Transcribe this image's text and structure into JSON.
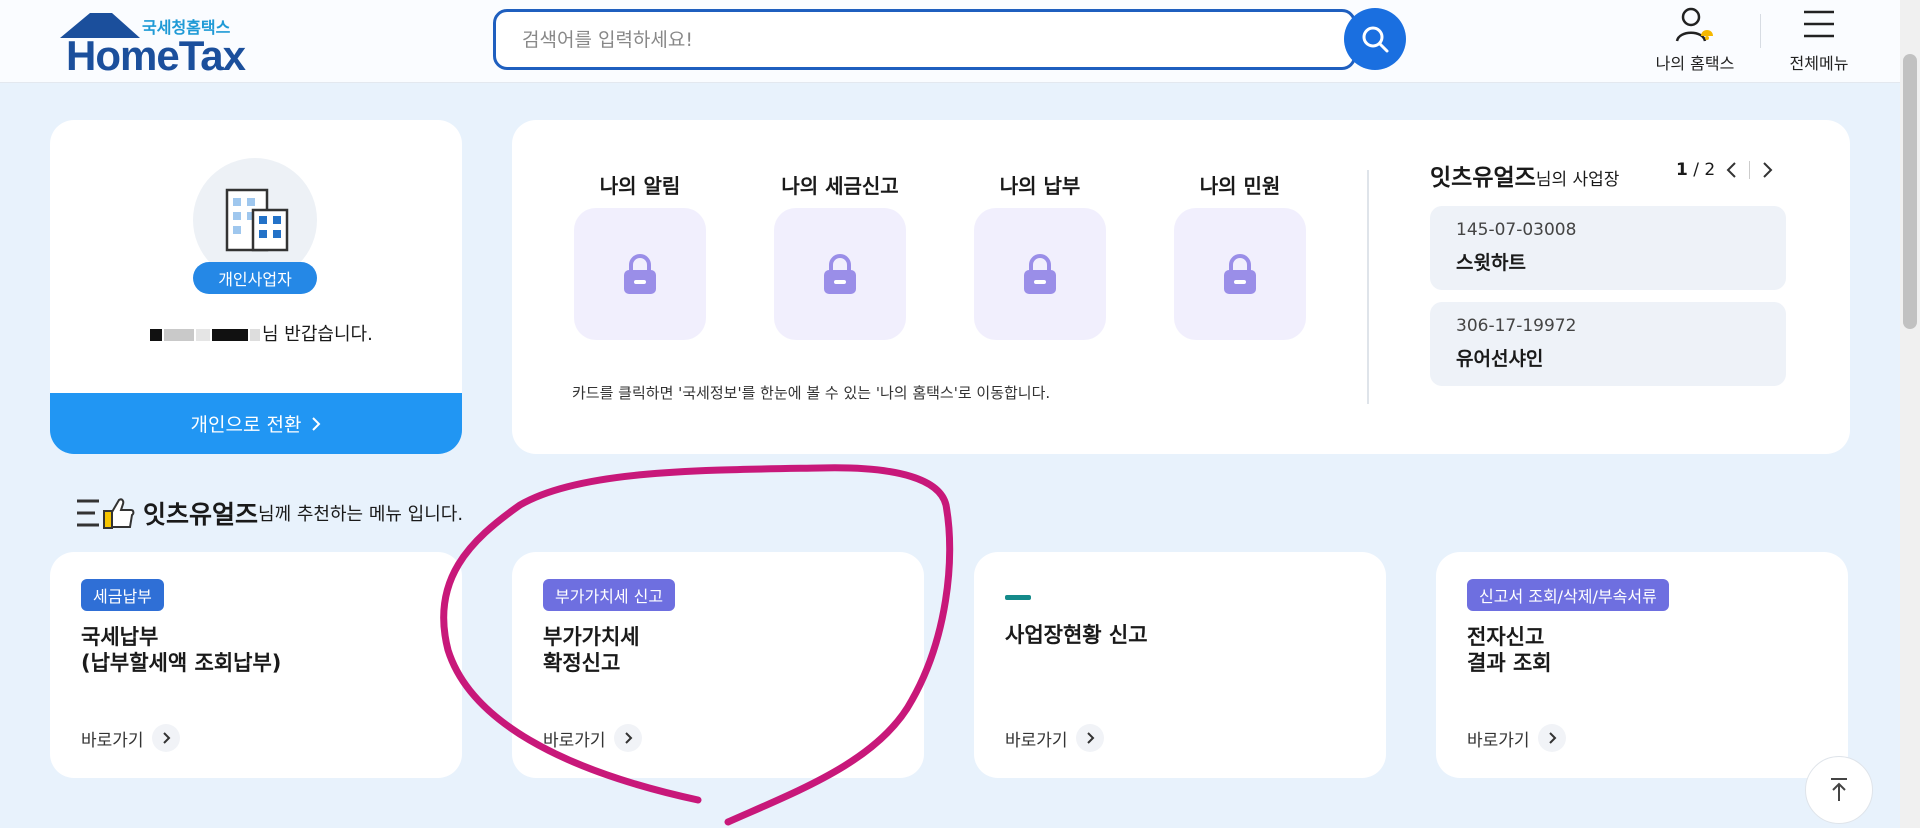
{
  "header": {
    "logo_small": "국세청홈택스",
    "logo_big": "HomeTax",
    "search_placeholder": "검색어를 입력하세요!",
    "my_hometax_label": "나의 홈택스",
    "all_menu_label": "전체메뉴"
  },
  "profile": {
    "badge": "개인사업자",
    "greeting_suffix": "님 반갑습니다.",
    "switch_label": "개인으로 전환"
  },
  "my_hometax": {
    "tiles": [
      {
        "title": "나의 알림"
      },
      {
        "title": "나의 세금신고"
      },
      {
        "title": "나의 납부"
      },
      {
        "title": "나의 민원"
      }
    ],
    "note": "카드를 클릭하면 '국세정보'를 한눈에 볼 수 있는 '나의 홈택스'로 이동합니다."
  },
  "business": {
    "owner": "잇츠유얼즈",
    "suffix": "님의 사업장",
    "page_current": "1",
    "page_total": "/ 2",
    "items": [
      {
        "number": "145-07-03008",
        "name": "스윗하트"
      },
      {
        "number": "306-17-19972",
        "name": "유어선샤인"
      }
    ]
  },
  "recommend": {
    "owner": "잇츠유얼즈",
    "suffix": "님께 추천하는 메뉴 입니다."
  },
  "menu_cards": [
    {
      "badge": "세금납부",
      "title": "국세납부\n(납부할세액 조회납부)",
      "link": "바로가기"
    },
    {
      "badge": "부가가치세 신고",
      "title": "부가가치세\n확정신고",
      "link": "바로가기"
    },
    {
      "badge": "",
      "title": "사업장현황 신고",
      "link": "바로가기"
    },
    {
      "badge": "신고서 조회/삭제/부속서류",
      "title": "전자신고\n결과 조회",
      "link": "바로가기"
    }
  ],
  "colors": {
    "page_bg": "#e8f2fc",
    "primary_blue": "#2196f3",
    "annotation_magenta": "#c8187a"
  }
}
